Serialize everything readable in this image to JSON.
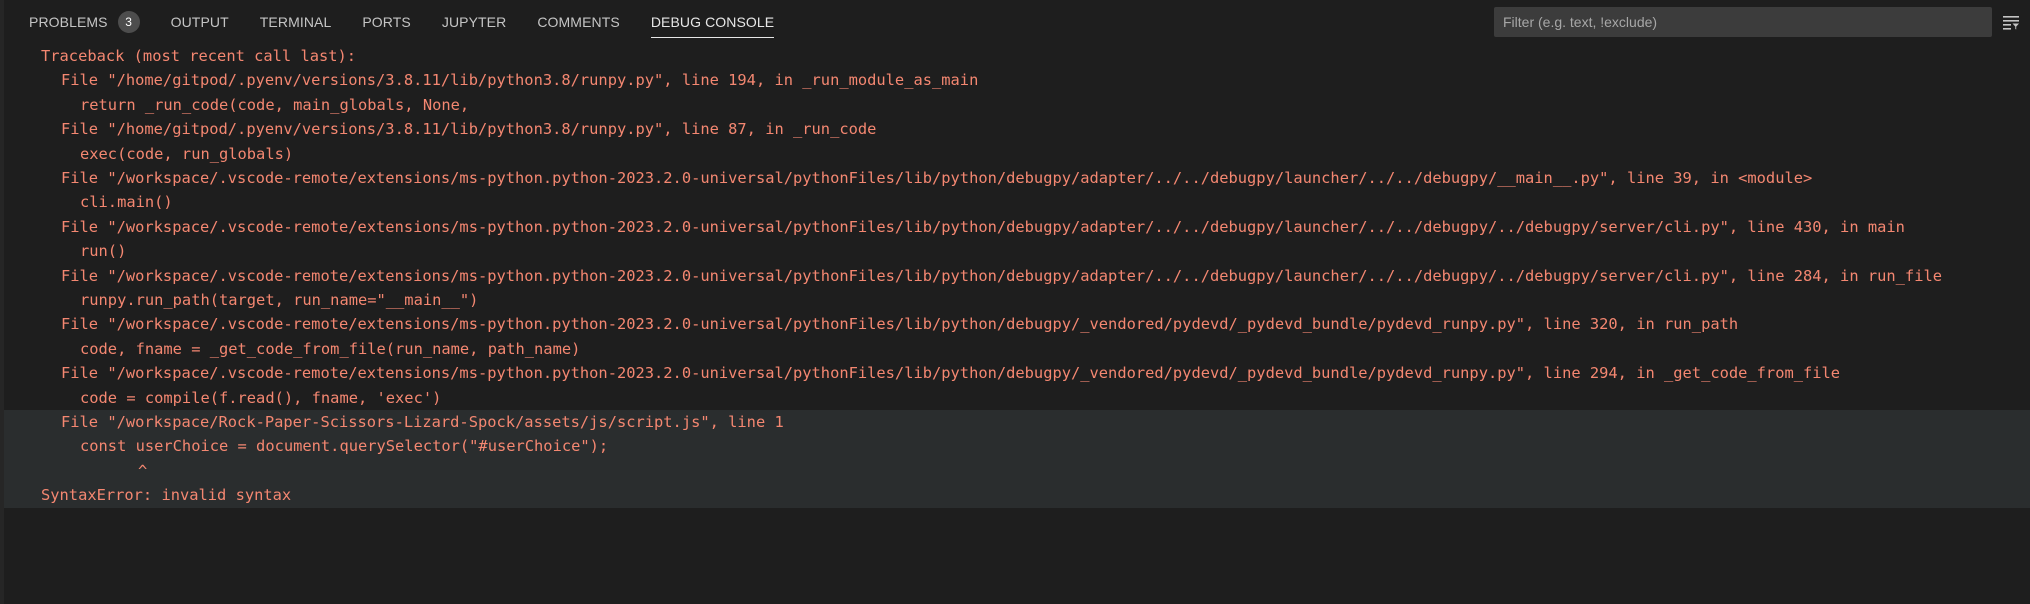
{
  "tabs": [
    {
      "label": "PROBLEMS",
      "badge": "3",
      "active": false
    },
    {
      "label": "OUTPUT",
      "active": false
    },
    {
      "label": "TERMINAL",
      "active": false
    },
    {
      "label": "PORTS",
      "active": false
    },
    {
      "label": "JUPYTER",
      "active": false
    },
    {
      "label": "COMMENTS",
      "active": false
    },
    {
      "label": "DEBUG CONSOLE",
      "active": true
    }
  ],
  "filter": {
    "placeholder": "Filter (e.g. text, !exclude)",
    "value": ""
  },
  "icons": {
    "filter_menu": "list-filter-icon"
  },
  "colors": {
    "error_text": "#f48771",
    "highlight_bg": "#2a2d2e",
    "panel_bg": "#1e1e1e"
  },
  "console": {
    "lines": [
      "Traceback (most recent call last):",
      "File \"/home/gitpod/.pyenv/versions/3.8.11/lib/python3.8/runpy.py\", line 194, in _run_module_as_main",
      "return _run_code(code, main_globals, None,",
      "File \"/home/gitpod/.pyenv/versions/3.8.11/lib/python3.8/runpy.py\", line 87, in _run_code",
      "exec(code, run_globals)",
      "File \"/workspace/.vscode-remote/extensions/ms-python.python-2023.2.0-universal/pythonFiles/lib/python/debugpy/adapter/../../debugpy/launcher/../../debugpy/__main__.py\", line 39, in <module>",
      "cli.main()",
      "File \"/workspace/.vscode-remote/extensions/ms-python.python-2023.2.0-universal/pythonFiles/lib/python/debugpy/adapter/../../debugpy/launcher/../../debugpy/../debugpy/server/cli.py\", line 430, in main",
      "run()",
      "File \"/workspace/.vscode-remote/extensions/ms-python.python-2023.2.0-universal/pythonFiles/lib/python/debugpy/adapter/../../debugpy/launcher/../../debugpy/../debugpy/server/cli.py\", line 284, in run_file",
      "runpy.run_path(target, run_name=\"__main__\")",
      "File \"/workspace/.vscode-remote/extensions/ms-python.python-2023.2.0-universal/pythonFiles/lib/python/debugpy/_vendored/pydevd/_pydevd_bundle/pydevd_runpy.py\", line 320, in run_path",
      "code, fname = _get_code_from_file(run_name, path_name)",
      "File \"/workspace/.vscode-remote/extensions/ms-python.python-2023.2.0-universal/pythonFiles/lib/python/debugpy/_vendored/pydevd/_pydevd_bundle/pydevd_runpy.py\", line 294, in _get_code_from_file",
      "code = compile(f.read(), fname, 'exec')"
    ],
    "highlight_lines": [
      "File \"/workspace/Rock-Paper-Scissors-Lizard-Spock/assets/js/script.js\", line 1",
      "const userChoice = document.querySelector(\"#userChoice\");",
      "^",
      "SyntaxError: invalid syntax"
    ]
  }
}
